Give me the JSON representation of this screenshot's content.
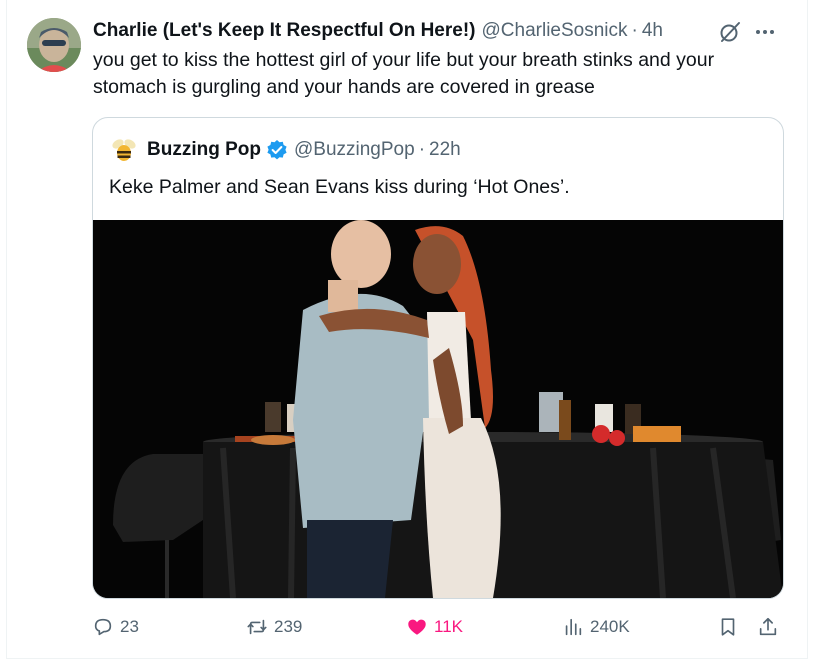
{
  "tweet": {
    "author_name": "Charlie (Let's Keep It Respectful On Here!)",
    "handle": "@CharlieSosnick",
    "separator": "·",
    "time": "4h",
    "text": "you get to kiss the hottest girl of your life but your breath stinks and your stomach is gurgling and your hands are covered in grease"
  },
  "quoted": {
    "author_name": "Buzzing Pop",
    "handle": "@BuzzingPop",
    "separator": "·",
    "time": "22h",
    "text": "Keke Palmer and Sean Evans kiss during ‘Hot Ones’."
  },
  "actions": {
    "replies": "23",
    "reposts": "239",
    "likes": "11K",
    "views": "240K"
  },
  "colors": {
    "text": "#0f1419",
    "secondary": "#536471",
    "verified": "#1d9bf0",
    "like": "#f91880",
    "border": "#cfd9de"
  },
  "icons": [
    "grok-icon",
    "more-icon",
    "verified-icon",
    "reply-icon",
    "retweet-icon",
    "heart-icon",
    "views-icon",
    "bookmark-icon",
    "share-icon"
  ]
}
